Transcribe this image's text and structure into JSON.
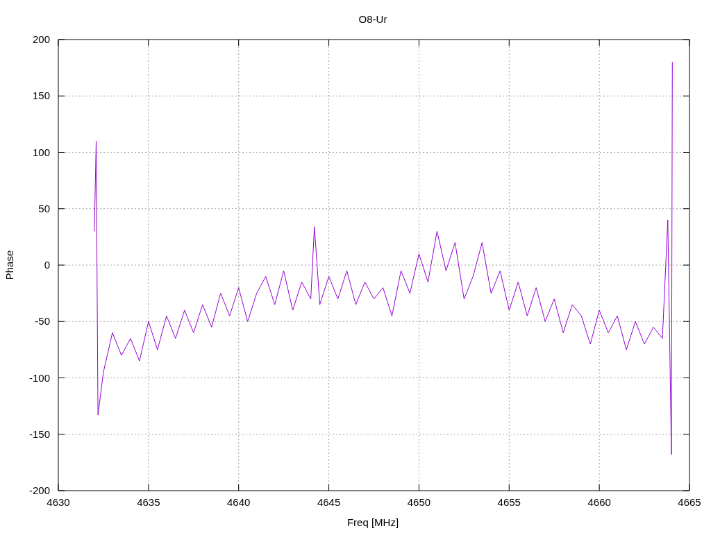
{
  "chart_data": {
    "type": "line",
    "title": "O8-Ur",
    "xlabel": "Freq [MHz]",
    "ylabel": "Phase",
    "xlim": [
      4630,
      4665
    ],
    "ylim": [
      -200,
      200
    ],
    "grid": true,
    "xticks": [
      4630,
      4635,
      4640,
      4645,
      4650,
      4655,
      4660,
      4665
    ],
    "yticks": [
      -200,
      -150,
      -100,
      -50,
      0,
      50,
      100,
      150,
      200
    ],
    "x": [
      4632,
      4632.1,
      4632.2,
      4632.5,
      4633,
      4633.5,
      4634,
      4634.5,
      4635,
      4635.5,
      4636,
      4636.5,
      4637,
      4637.5,
      4638,
      4638.5,
      4639,
      4639.5,
      4640,
      4640.5,
      4641,
      4641.5,
      4642,
      4642.5,
      4643,
      4643.5,
      4644,
      4644.2,
      4644.5,
      4645,
      4645.5,
      4646,
      4646.5,
      4647,
      4647.5,
      4648,
      4648.5,
      4649,
      4649.5,
      4650,
      4650.5,
      4651,
      4651.5,
      4652,
      4652.5,
      4653,
      4653.5,
      4654,
      4654.5,
      4655,
      4655.5,
      4656,
      4656.5,
      4657,
      4657.5,
      4658,
      4658.5,
      4659,
      4659.5,
      4660,
      4660.5,
      4661,
      4661.5,
      4662,
      4662.5,
      4663,
      4663.5,
      4663.8,
      4664,
      4664.05
    ],
    "series": [
      {
        "color": "#9400d3",
        "values": [
          30,
          110,
          -133,
          -95,
          -60,
          -80,
          -65,
          -85,
          -50,
          -75,
          -45,
          -65,
          -40,
          -60,
          -35,
          -55,
          -25,
          -45,
          -20,
          -50,
          -25,
          -10,
          -35,
          -5,
          -40,
          -15,
          -30,
          34,
          -35,
          -10,
          -30,
          -5,
          -35,
          -15,
          -30,
          -20,
          -45,
          -5,
          -25,
          10,
          -15,
          30,
          -5,
          20,
          -30,
          -10,
          20,
          -25,
          -5,
          -40,
          -15,
          -45,
          -20,
          -50,
          -30,
          -60,
          -35,
          -45,
          -70,
          -40,
          -60,
          -45,
          -75,
          -50,
          -70,
          -55,
          -65,
          40,
          -168,
          180
        ]
      }
    ]
  }
}
